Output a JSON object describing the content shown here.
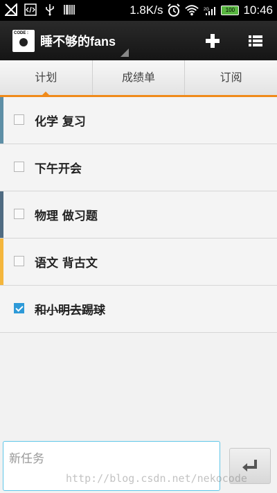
{
  "status_bar": {
    "network_speed": "1.8K/s",
    "signal_label": "2G",
    "battery_level": "100",
    "time": "10:46",
    "icons": [
      "no-signal-icon",
      "code-icon",
      "usb-icon",
      "barcode-icon",
      "alarm-icon",
      "wifi-icon",
      "signal-icon",
      "battery-icon"
    ]
  },
  "app_bar": {
    "logo_text": "CODE :",
    "title": "睡不够的fans",
    "add_icon": "plus-icon",
    "menu_icon": "list-icon"
  },
  "tabs": [
    {
      "label": "计划",
      "active": true
    },
    {
      "label": "成绩单",
      "active": false
    },
    {
      "label": "订阅",
      "active": false
    }
  ],
  "tasks": [
    {
      "label": "化学 复习",
      "checked": false,
      "color": "#5e8fa6"
    },
    {
      "label": "下午开会",
      "checked": false,
      "color": ""
    },
    {
      "label": "物理 做习题",
      "checked": false,
      "color": "#4f6b82"
    },
    {
      "label": "语文 背古文",
      "checked": false,
      "color": "#f4b63c"
    },
    {
      "label": "和小明去踢球",
      "checked": true,
      "color": ""
    }
  ],
  "input": {
    "placeholder": "新任务",
    "value": ""
  },
  "enter_icon": "enter-icon",
  "watermark": "http://blog.csdn.net/nekocode",
  "colors": {
    "accent": "#f08a1a",
    "input_border": "#5ec5e8",
    "checkbox_checked": "#2e9ad8"
  }
}
